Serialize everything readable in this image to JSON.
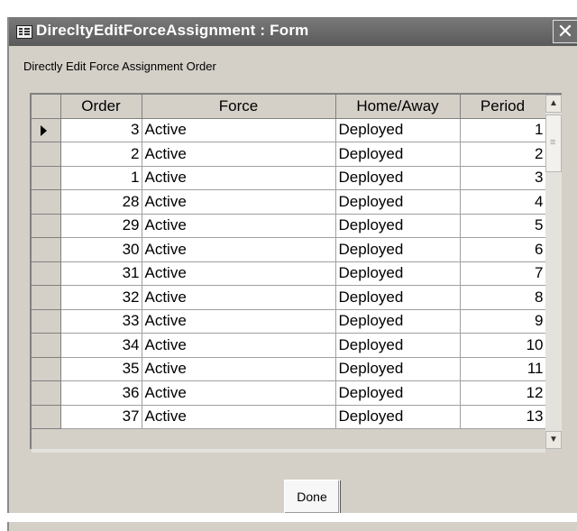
{
  "window": {
    "title": "DirecltyEditForceAssignment : Form",
    "close_label": "✕"
  },
  "form": {
    "caption": "Directly Edit Force Assignment Order",
    "done_label": "Done"
  },
  "grid": {
    "columns": [
      "Order",
      "Force",
      "Home/Away",
      "Period"
    ],
    "selected_row": 0,
    "rows": [
      [
        "3",
        "Active",
        "Deployed",
        "1"
      ],
      [
        "2",
        "Active",
        "Deployed",
        "2"
      ],
      [
        "1",
        "Active",
        "Deployed",
        "3"
      ],
      [
        "28",
        "Active",
        "Deployed",
        "4"
      ],
      [
        "29",
        "Active",
        "Deployed",
        "5"
      ],
      [
        "30",
        "Active",
        "Deployed",
        "6"
      ],
      [
        "31",
        "Active",
        "Deployed",
        "7"
      ],
      [
        "32",
        "Active",
        "Deployed",
        "8"
      ],
      [
        "33",
        "Active",
        "Deployed",
        "9"
      ],
      [
        "34",
        "Active",
        "Deployed",
        "10"
      ],
      [
        "35",
        "Active",
        "Deployed",
        "11"
      ],
      [
        "36",
        "Active",
        "Deployed",
        "12"
      ],
      [
        "37",
        "Active",
        "Deployed",
        "13"
      ]
    ]
  },
  "icons": {
    "title": "form-icon",
    "selector": "current-record-arrow-icon",
    "scroll_up": "scroll-up-arrow-icon",
    "scroll_down": "scroll-down-arrow-icon"
  }
}
